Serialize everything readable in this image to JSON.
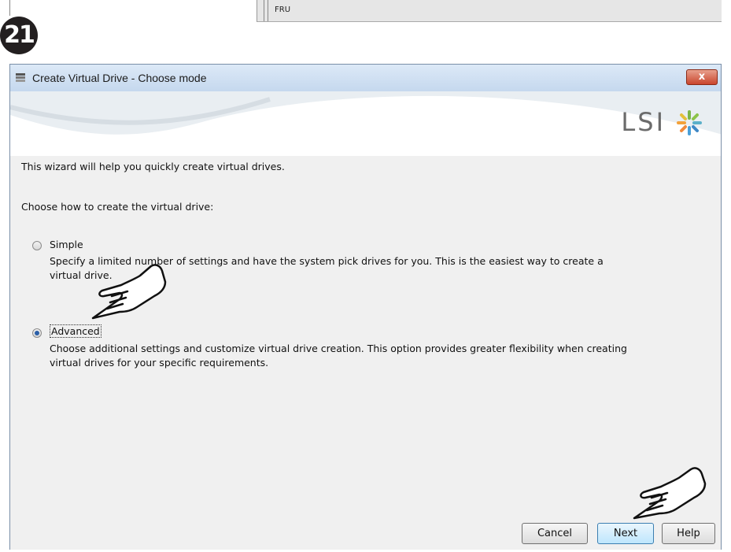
{
  "step_number": "21",
  "previous_fragment": {
    "text": "FRU"
  },
  "window": {
    "title": "Create Virtual Drive - Choose mode",
    "close_label": "x"
  },
  "banner": {
    "logo_text": "LSI"
  },
  "content": {
    "intro": "This wizard will help you quickly create virtual drives.",
    "question": "Choose how to create the virtual drive:",
    "options": [
      {
        "label": "Simple",
        "description_line1": "Specify a limited number of settings and have the system pick drives for you. This is the easiest way to create a",
        "description_line2": "virtual drive.",
        "selected": false
      },
      {
        "label": "Advanced",
        "description_line1": "Choose additional settings and customize virtual drive creation. This option provides greater flexibility when creating",
        "description_line2": "virtual drives for your specific requirements.",
        "selected": true
      }
    ]
  },
  "buttons": {
    "cancel": "Cancel",
    "next": "Next",
    "help": "Help"
  },
  "icons": [
    "app-icon",
    "close-icon",
    "lsi-star-icon",
    "pointing-hand-icon"
  ],
  "colors": {
    "titlebar": "#c5d8ee",
    "close": "#c9452d",
    "radio_selected": "#2b5fa8",
    "next_border": "#3c7fb1"
  }
}
